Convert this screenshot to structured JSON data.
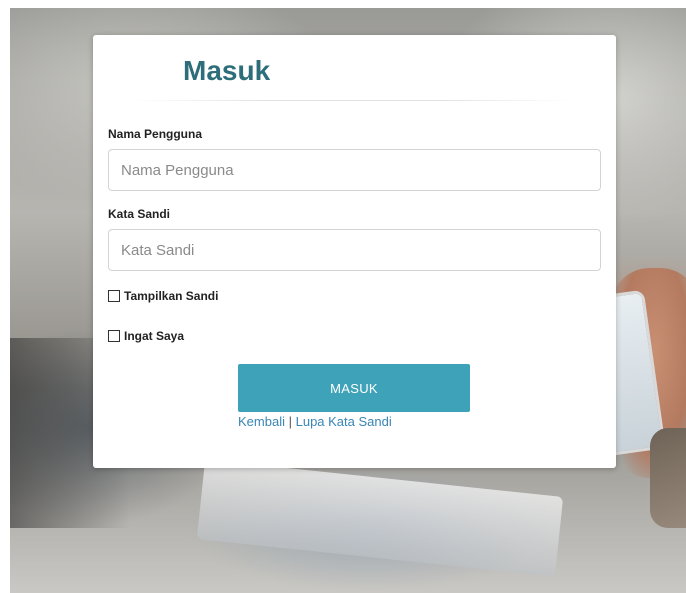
{
  "login": {
    "title": "Masuk",
    "username_label": "Nama Pengguna",
    "username_placeholder": "Nama Pengguna",
    "password_label": "Kata Sandi",
    "password_placeholder": "Kata Sandi",
    "show_password_label": "Tampilkan Sandi",
    "remember_me_label": "Ingat Saya",
    "submit_label": "MASUK",
    "back_link": "Kembali",
    "separator": "|",
    "forgot_link": "Lupa Kata Sandi"
  },
  "colors": {
    "title": "#2d6e7a",
    "button": "#3ea3b8",
    "link": "#3a86b5"
  }
}
